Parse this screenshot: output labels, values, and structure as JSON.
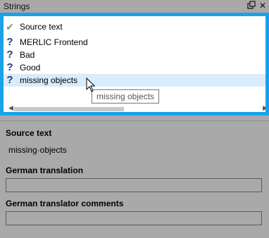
{
  "panel": {
    "title": "Strings",
    "float_icon": "restore-icon",
    "close_icon": "close-icon"
  },
  "strings_list": {
    "items": [
      {
        "icon": "check-icon",
        "label": "Source text",
        "selected": false
      },
      {
        "icon": "question-icon",
        "label": "MERLIC Frontend",
        "selected": false
      },
      {
        "icon": "question-icon",
        "label": "Bad",
        "selected": false
      },
      {
        "icon": "question-icon",
        "label": "Good",
        "selected": false
      },
      {
        "icon": "question-icon",
        "label": "missing objects",
        "selected": true
      }
    ],
    "tooltip": "missing objects",
    "selection_color": "#d8ecfb",
    "focus_border_color": "#1aa1e6"
  },
  "details": {
    "source_header": "Source text",
    "source_value": "missing·objects",
    "translation_header": "German translation",
    "translation_value": "",
    "comments_header": "German translator comments",
    "comments_value": ""
  }
}
